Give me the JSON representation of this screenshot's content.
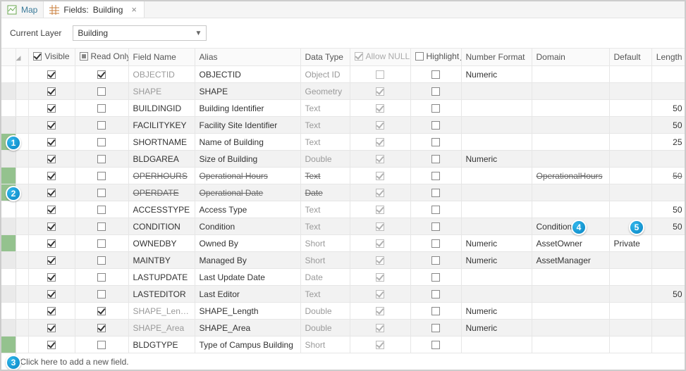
{
  "tabs": {
    "map": "Map",
    "fields_prefix": "Fields:",
    "fields_layer": "Building"
  },
  "layerbar": {
    "label": "Current Layer",
    "value": "Building"
  },
  "headers": {
    "visible": "Visible",
    "readonly": "Read Only",
    "fieldname": "Field Name",
    "alias": "Alias",
    "datatype": "Data Type",
    "allownull": "Allow NULL",
    "highlight": "Highlight",
    "numberformat": "Number Format",
    "domain": "Domain",
    "default": "Default",
    "length": "Length"
  },
  "footer": "Click here to add a new field.",
  "callouts": {
    "c1": "1",
    "c2": "2",
    "c3": "3",
    "c4": "4",
    "c5": "5"
  },
  "rows": [
    {
      "shaded": false,
      "green": false,
      "strike": false,
      "vis": true,
      "ro": true,
      "roDis": false,
      "fn": "OBJECTID",
      "fnDim": true,
      "alias": "OBJECTID",
      "dt": "Object ID",
      "dtDim": true,
      "an": false,
      "anDis": true,
      "hl": false,
      "nf": "Numeric",
      "dom": "",
      "def": "",
      "len": ""
    },
    {
      "shaded": true,
      "green": false,
      "strike": false,
      "vis": true,
      "ro": false,
      "roDis": false,
      "fn": "SHAPE",
      "fnDim": true,
      "alias": "SHAPE",
      "dt": "Geometry",
      "dtDim": true,
      "an": true,
      "anDis": true,
      "hl": false,
      "nf": "",
      "dom": "",
      "def": "",
      "len": ""
    },
    {
      "shaded": false,
      "green": false,
      "strike": false,
      "vis": true,
      "ro": false,
      "roDis": false,
      "fn": "BUILDINGID",
      "fnDim": false,
      "alias": "Building Identifier",
      "dt": "Text",
      "dtDim": true,
      "an": true,
      "anDis": true,
      "hl": false,
      "nf": "",
      "dom": "",
      "def": "",
      "len": "50"
    },
    {
      "shaded": true,
      "green": false,
      "strike": false,
      "vis": true,
      "ro": false,
      "roDis": false,
      "fn": "FACILITYKEY",
      "fnDim": false,
      "alias": "Facility Site Identifier",
      "dt": "Text",
      "dtDim": true,
      "an": true,
      "anDis": true,
      "hl": false,
      "nf": "",
      "dom": "",
      "def": "",
      "len": "50"
    },
    {
      "shaded": false,
      "green": true,
      "strike": false,
      "vis": true,
      "ro": false,
      "roDis": false,
      "fn": "SHORTNAME",
      "fnDim": false,
      "alias": "Name of Building",
      "dt": "Text",
      "dtDim": true,
      "an": true,
      "anDis": true,
      "hl": false,
      "nf": "",
      "dom": "",
      "def": "",
      "len": "25"
    },
    {
      "shaded": true,
      "green": false,
      "strike": false,
      "vis": true,
      "ro": false,
      "roDis": false,
      "fn": "BLDGAREA",
      "fnDim": false,
      "alias": "Size of Building",
      "dt": "Double",
      "dtDim": true,
      "an": true,
      "anDis": true,
      "hl": false,
      "nf": "Numeric",
      "dom": "",
      "def": "",
      "len": ""
    },
    {
      "shaded": false,
      "green": true,
      "strike": true,
      "vis": true,
      "ro": false,
      "roDis": false,
      "fn": "OPERHOURS",
      "fnDim": false,
      "alias": "Operational Hours",
      "dt": "Text",
      "dtDim": false,
      "an": true,
      "anDis": true,
      "hl": false,
      "nf": "",
      "dom": "OperationalHours",
      "def": "",
      "len": "50"
    },
    {
      "shaded": true,
      "green": true,
      "strike": true,
      "vis": true,
      "ro": false,
      "roDis": false,
      "fn": "OPERDATE",
      "fnDim": false,
      "alias": "Operational Date",
      "dt": "Date",
      "dtDim": false,
      "an": true,
      "anDis": true,
      "hl": false,
      "nf": "",
      "dom": "",
      "def": "",
      "len": ""
    },
    {
      "shaded": false,
      "green": false,
      "strike": false,
      "vis": true,
      "ro": false,
      "roDis": false,
      "fn": "ACCESSTYPE",
      "fnDim": false,
      "alias": "Access Type",
      "dt": "Text",
      "dtDim": true,
      "an": true,
      "anDis": true,
      "hl": false,
      "nf": "",
      "dom": "",
      "def": "",
      "len": "50"
    },
    {
      "shaded": true,
      "green": false,
      "strike": false,
      "vis": true,
      "ro": false,
      "roDis": false,
      "fn": "CONDITION",
      "fnDim": false,
      "alias": "Condition",
      "dt": "Text",
      "dtDim": true,
      "an": true,
      "anDis": true,
      "hl": false,
      "nf": "",
      "dom": "Condition",
      "def": "",
      "len": "50"
    },
    {
      "shaded": false,
      "green": true,
      "strike": false,
      "vis": true,
      "ro": false,
      "roDis": false,
      "fn": "OWNEDBY",
      "fnDim": false,
      "alias": "Owned By",
      "dt": "Short",
      "dtDim": true,
      "an": true,
      "anDis": true,
      "hl": false,
      "nf": "Numeric",
      "dom": "AssetOwner",
      "def": "Private",
      "len": ""
    },
    {
      "shaded": true,
      "green": false,
      "strike": false,
      "vis": true,
      "ro": false,
      "roDis": false,
      "fn": "MAINTBY",
      "fnDim": false,
      "alias": "Managed By",
      "dt": "Short",
      "dtDim": true,
      "an": true,
      "anDis": true,
      "hl": false,
      "nf": "Numeric",
      "dom": "AssetManager",
      "def": "",
      "len": ""
    },
    {
      "shaded": false,
      "green": false,
      "strike": false,
      "vis": true,
      "ro": false,
      "roDis": false,
      "fn": "LASTUPDATE",
      "fnDim": false,
      "alias": "Last Update Date",
      "dt": "Date",
      "dtDim": true,
      "an": true,
      "anDis": true,
      "hl": false,
      "nf": "",
      "dom": "",
      "def": "",
      "len": ""
    },
    {
      "shaded": true,
      "green": false,
      "strike": false,
      "vis": true,
      "ro": false,
      "roDis": false,
      "fn": "LASTEDITOR",
      "fnDim": false,
      "alias": "Last Editor",
      "dt": "Text",
      "dtDim": true,
      "an": true,
      "anDis": true,
      "hl": false,
      "nf": "",
      "dom": "",
      "def": "",
      "len": "50"
    },
    {
      "shaded": false,
      "green": false,
      "strike": false,
      "vis": true,
      "ro": true,
      "roDis": false,
      "fn": "SHAPE_Length",
      "fnDim": true,
      "alias": "SHAPE_Length",
      "dt": "Double",
      "dtDim": true,
      "an": true,
      "anDis": true,
      "hl": false,
      "nf": "Numeric",
      "dom": "",
      "def": "",
      "len": ""
    },
    {
      "shaded": true,
      "green": false,
      "strike": false,
      "vis": true,
      "ro": true,
      "roDis": false,
      "fn": "SHAPE_Area",
      "fnDim": true,
      "alias": "SHAPE_Area",
      "dt": "Double",
      "dtDim": true,
      "an": true,
      "anDis": true,
      "hl": false,
      "nf": "Numeric",
      "dom": "",
      "def": "",
      "len": ""
    },
    {
      "shaded": false,
      "green": true,
      "strike": false,
      "vis": true,
      "ro": false,
      "roDis": false,
      "fn": "BLDGTYPE",
      "fnDim": false,
      "alias": "Type of Campus Building",
      "dt": "Short",
      "dtDim": true,
      "an": true,
      "anDis": true,
      "hl": false,
      "nf": "",
      "dom": "",
      "def": "",
      "len": ""
    }
  ]
}
